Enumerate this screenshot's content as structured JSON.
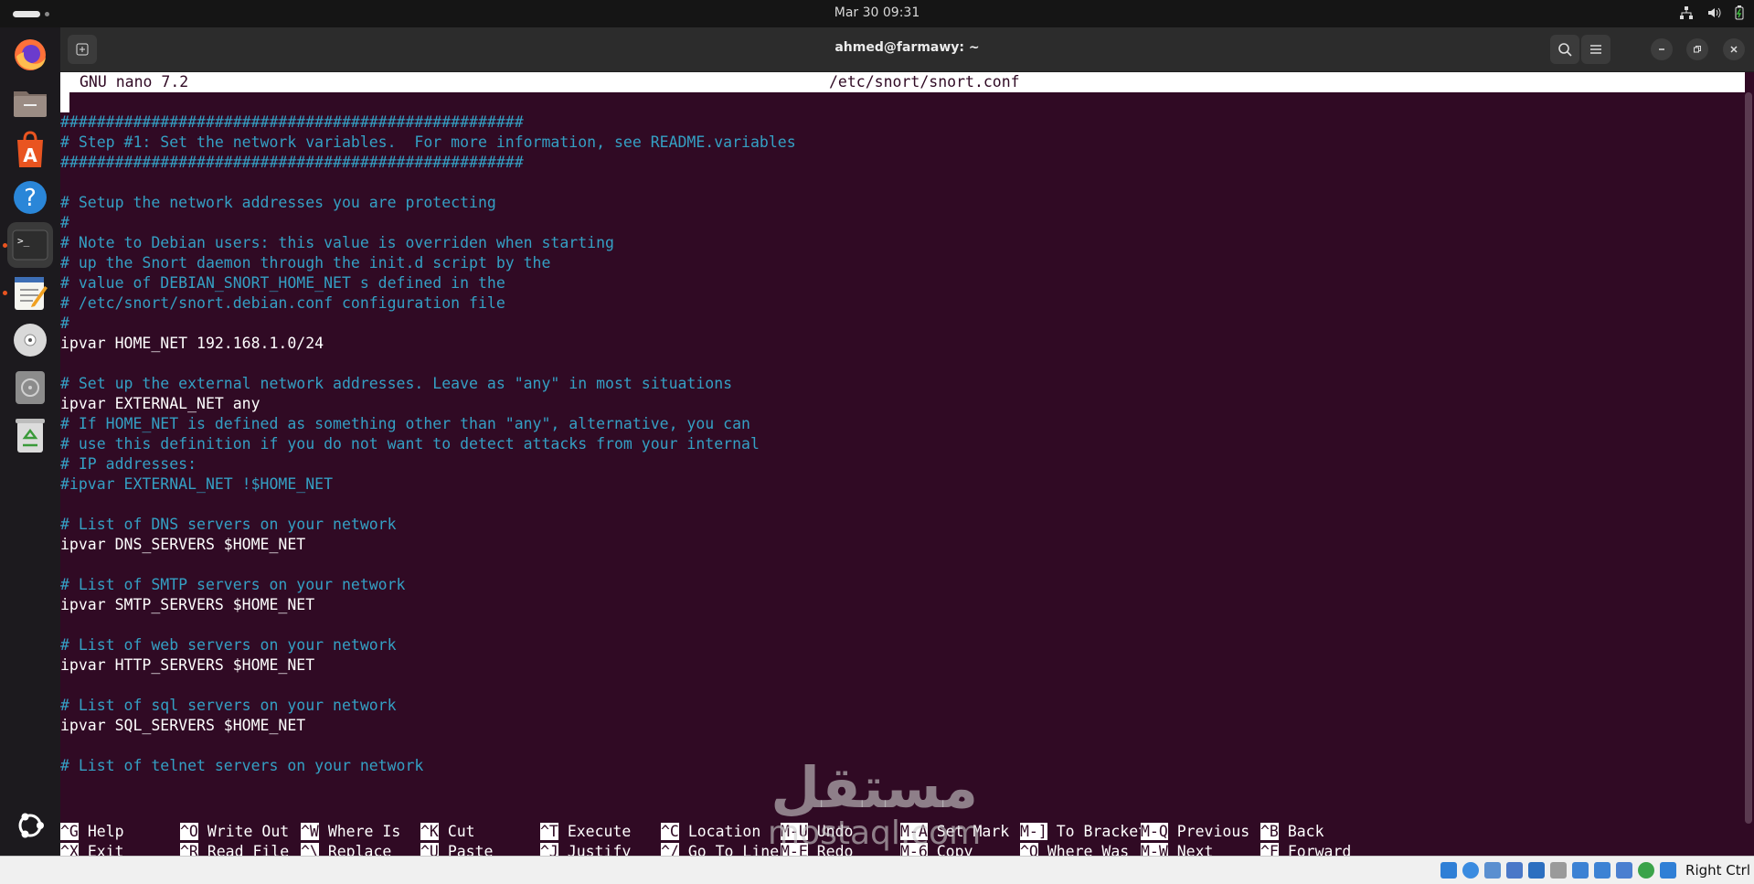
{
  "topbar": {
    "clock": "Mar 30  09:31"
  },
  "dock": {
    "items": [
      {
        "name": "firefox-icon"
      },
      {
        "name": "files-icon"
      },
      {
        "name": "app-center-icon"
      },
      {
        "name": "help-icon"
      },
      {
        "name": "terminal-icon"
      },
      {
        "name": "text-editor-icon"
      },
      {
        "name": "disc-icon"
      },
      {
        "name": "drive-icon"
      },
      {
        "name": "trash-icon"
      }
    ],
    "show_apps_icon": "ubuntu-logo-icon"
  },
  "window": {
    "title": "ahmed@farmawy: ~"
  },
  "nano": {
    "version": "GNU nano 7.2",
    "filename": "/etc/snort/snort.conf",
    "lines": [
      {
        "text": "###################################################",
        "comment": true
      },
      {
        "text": "# Step #1: Set the network variables.  For more information, see README.variables",
        "comment": true
      },
      {
        "text": "###################################################",
        "comment": true
      },
      {
        "text": "",
        "comment": false
      },
      {
        "text": "# Setup the network addresses you are protecting",
        "comment": true
      },
      {
        "text": "#",
        "comment": true
      },
      {
        "text": "# Note to Debian users: this value is overriden when starting",
        "comment": true
      },
      {
        "text": "# up the Snort daemon through the init.d script by the",
        "comment": true
      },
      {
        "text": "# value of DEBIAN_SNORT_HOME_NET s defined in the",
        "comment": true
      },
      {
        "text": "# /etc/snort/snort.debian.conf configuration file",
        "comment": true
      },
      {
        "text": "#",
        "comment": true
      },
      {
        "text": "ipvar HOME_NET 192.168.1.0/24",
        "comment": false
      },
      {
        "text": "",
        "comment": false
      },
      {
        "text": "# Set up the external network addresses. Leave as \"any\" in most situations",
        "comment": true
      },
      {
        "text": "ipvar EXTERNAL_NET any",
        "comment": false
      },
      {
        "text": "# If HOME_NET is defined as something other than \"any\", alternative, you can",
        "comment": true
      },
      {
        "text": "# use this definition if you do not want to detect attacks from your internal",
        "comment": true
      },
      {
        "text": "# IP addresses:",
        "comment": true
      },
      {
        "text": "#ipvar EXTERNAL_NET !$HOME_NET",
        "comment": true
      },
      {
        "text": "",
        "comment": false
      },
      {
        "text": "# List of DNS servers on your network",
        "comment": true
      },
      {
        "text": "ipvar DNS_SERVERS $HOME_NET",
        "comment": false
      },
      {
        "text": "",
        "comment": false
      },
      {
        "text": "# List of SMTP servers on your network",
        "comment": true
      },
      {
        "text": "ipvar SMTP_SERVERS $HOME_NET",
        "comment": false
      },
      {
        "text": "",
        "comment": false
      },
      {
        "text": "# List of web servers on your network",
        "comment": true
      },
      {
        "text": "ipvar HTTP_SERVERS $HOME_NET",
        "comment": false
      },
      {
        "text": "",
        "comment": false
      },
      {
        "text": "# List of sql servers on your network",
        "comment": true
      },
      {
        "text": "ipvar SQL_SERVERS $HOME_NET",
        "comment": false
      },
      {
        "text": "",
        "comment": false
      },
      {
        "text": "# List of telnet servers on your network",
        "comment": true
      }
    ],
    "shortcuts": [
      [
        {
          "key": "^G",
          "label": "Help"
        },
        {
          "key": "^X",
          "label": "Exit"
        }
      ],
      [
        {
          "key": "^O",
          "label": "Write Out"
        },
        {
          "key": "^R",
          "label": "Read File"
        }
      ],
      [
        {
          "key": "^W",
          "label": "Where Is"
        },
        {
          "key": "^\\",
          "label": "Replace"
        }
      ],
      [
        {
          "key": "^K",
          "label": "Cut"
        },
        {
          "key": "^U",
          "label": "Paste"
        }
      ],
      [
        {
          "key": "^T",
          "label": "Execute"
        },
        {
          "key": "^J",
          "label": "Justify"
        }
      ],
      [
        {
          "key": "^C",
          "label": "Location"
        },
        {
          "key": "^/",
          "label": "Go To Line"
        }
      ],
      [
        {
          "key": "M-U",
          "label": "Undo"
        },
        {
          "key": "M-E",
          "label": "Redo"
        }
      ],
      [
        {
          "key": "M-A",
          "label": "Set Mark"
        },
        {
          "key": "M-6",
          "label": "Copy"
        }
      ],
      [
        {
          "key": "M-]",
          "label": "To Bracket"
        },
        {
          "key": "^Q",
          "label": "Where Was"
        }
      ],
      [
        {
          "key": "M-Q",
          "label": "Previous"
        },
        {
          "key": "M-W",
          "label": "Next"
        }
      ],
      [
        {
          "key": "^B",
          "label": "Back"
        },
        {
          "key": "^F",
          "label": "Forward"
        }
      ]
    ]
  },
  "watermark": {
    "arabic": "مستقل",
    "latin": "mostaql.com"
  },
  "vm_statusbar": {
    "host_key": "Right Ctrl"
  },
  "colors": {
    "terminal_bg": "#300a24",
    "comment": "#34a0c4",
    "text": "#ffffff",
    "accent": "#e95420"
  }
}
